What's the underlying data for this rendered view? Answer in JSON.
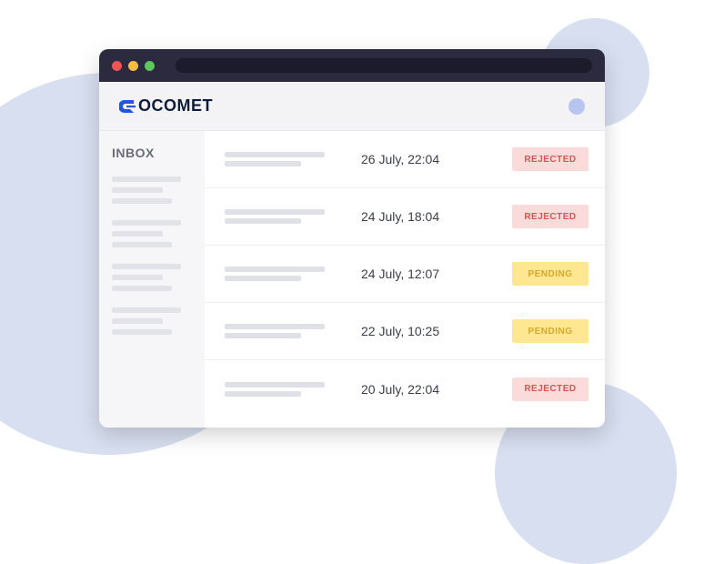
{
  "brand": {
    "name": "OCOMET",
    "mark_text": "G"
  },
  "sidebar": {
    "title": "INBOX"
  },
  "rows": [
    {
      "date": "26 July, 22:04",
      "status": "REJECTED",
      "status_kind": "rejected"
    },
    {
      "date": "24 July, 18:04",
      "status": "REJECTED",
      "status_kind": "rejected"
    },
    {
      "date": "24 July, 12:07",
      "status": "PENDING",
      "status_kind": "pending"
    },
    {
      "date": "22 July, 10:25",
      "status": "PENDING",
      "status_kind": "pending"
    },
    {
      "date": "20 July, 22:04",
      "status": "REJECTED",
      "status_kind": "rejected"
    }
  ],
  "colors": {
    "rejected_bg": "#fbdada",
    "rejected_fg": "#d65454",
    "pending_bg": "#ffe791",
    "pending_fg": "#d4a92e",
    "brand_blue": "#2556d9"
  }
}
